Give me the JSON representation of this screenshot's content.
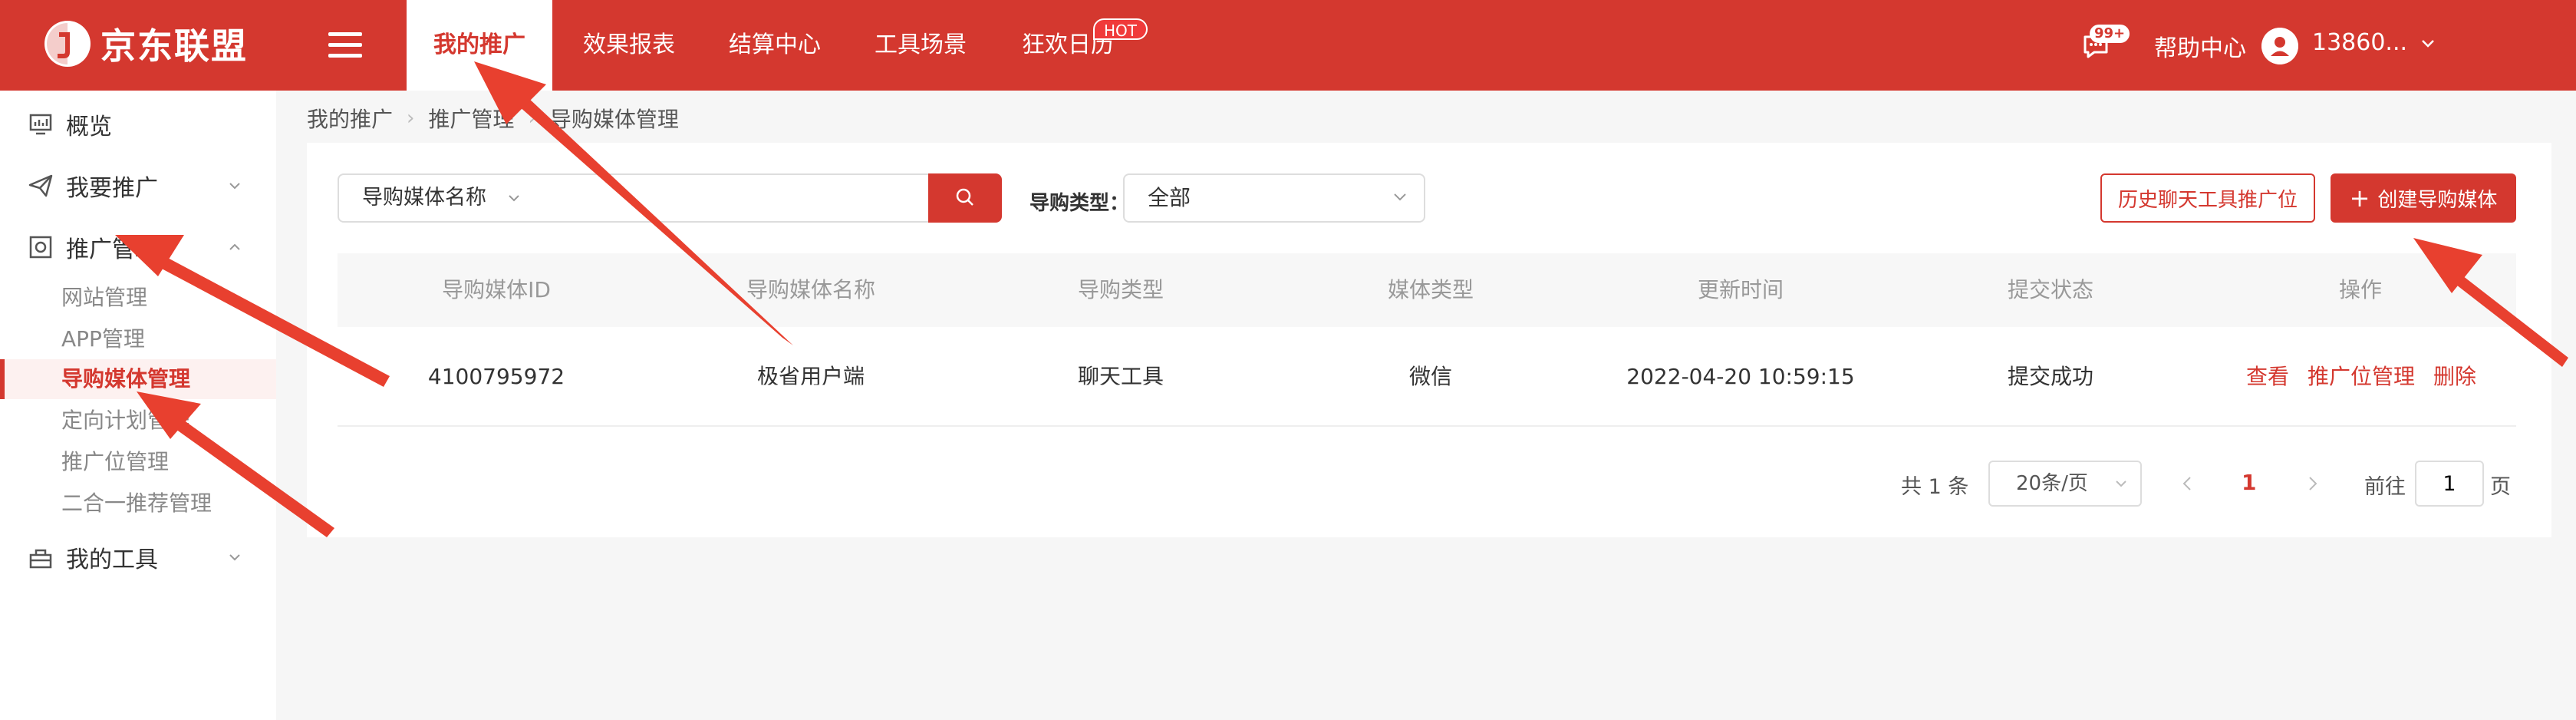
{
  "brand": {
    "name": "京东联盟",
    "accent": "#d4382f"
  },
  "nav": {
    "items": [
      {
        "label": "我的推广",
        "active": true
      },
      {
        "label": "效果报表"
      },
      {
        "label": "结算中心"
      },
      {
        "label": "工具场景"
      },
      {
        "label": "狂欢日历"
      }
    ],
    "hot_badge": "HOT",
    "message_badge": "99+",
    "help": "帮助中心",
    "user": "13860..."
  },
  "sidebar": {
    "items": [
      {
        "label": "概览",
        "icon": "dashboard-icon"
      },
      {
        "label": "我要推广",
        "icon": "paper-plane-icon"
      },
      {
        "label": "推广管理",
        "icon": "target-icon"
      },
      {
        "label": "我的工具",
        "icon": "toolbox-icon"
      }
    ],
    "subitems": [
      {
        "label": "网站管理"
      },
      {
        "label": "APP管理"
      },
      {
        "label": "导购媒体管理",
        "active": true
      },
      {
        "label": "定向计划管理"
      },
      {
        "label": "推广位管理"
      },
      {
        "label": "二合一推荐管理"
      }
    ]
  },
  "breadcrumb": [
    "我的推广",
    "推广管理",
    "导购媒体管理"
  ],
  "filter": {
    "field_select": "导购媒体名称",
    "search_placeholder": "",
    "type_label": "导购类型：",
    "type_value": "全部"
  },
  "actions": {
    "history_button": "历史聊天工具推广位",
    "create_button": "创建导购媒体",
    "create_plus": "+"
  },
  "table": {
    "columns": [
      "导购媒体ID",
      "导购媒体名称",
      "导购类型",
      "媒体类型",
      "更新时间",
      "提交状态",
      "操作"
    ],
    "rows": [
      {
        "id": "4100795972",
        "name": "极省用户端",
        "type": "聊天工具",
        "media": "微信",
        "updated": "2022-04-20 10:59:15",
        "status": "提交成功",
        "ops": [
          "查看",
          "推广位管理",
          "删除"
        ]
      }
    ]
  },
  "pagination": {
    "total": "共 1 条",
    "page_size": "20条/页",
    "current": "1",
    "goto_label": "前往",
    "goto_value": "1",
    "suffix": "页"
  }
}
